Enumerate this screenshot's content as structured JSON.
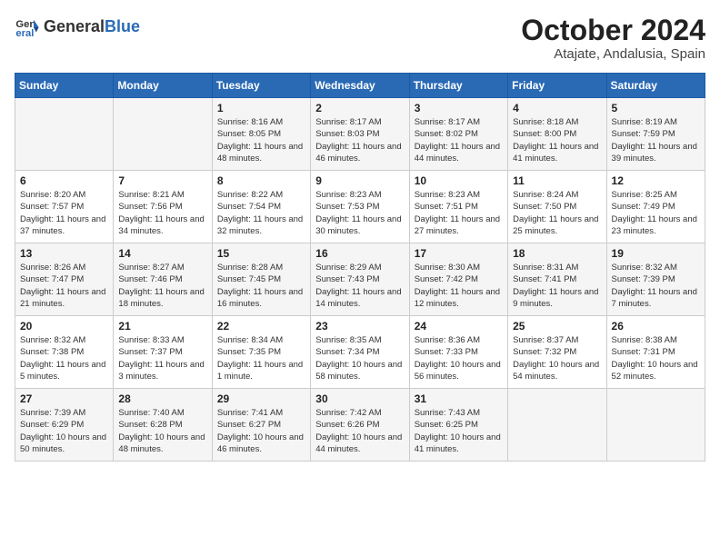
{
  "header": {
    "logo_general": "General",
    "logo_blue": "Blue",
    "month_title": "October 2024",
    "location": "Atajate, Andalusia, Spain"
  },
  "calendar": {
    "days_of_week": [
      "Sunday",
      "Monday",
      "Tuesday",
      "Wednesday",
      "Thursday",
      "Friday",
      "Saturday"
    ],
    "weeks": [
      [
        {
          "day": "",
          "info": ""
        },
        {
          "day": "",
          "info": ""
        },
        {
          "day": "1",
          "info": "Sunrise: 8:16 AM\nSunset: 8:05 PM\nDaylight: 11 hours and 48 minutes."
        },
        {
          "day": "2",
          "info": "Sunrise: 8:17 AM\nSunset: 8:03 PM\nDaylight: 11 hours and 46 minutes."
        },
        {
          "day": "3",
          "info": "Sunrise: 8:17 AM\nSunset: 8:02 PM\nDaylight: 11 hours and 44 minutes."
        },
        {
          "day": "4",
          "info": "Sunrise: 8:18 AM\nSunset: 8:00 PM\nDaylight: 11 hours and 41 minutes."
        },
        {
          "day": "5",
          "info": "Sunrise: 8:19 AM\nSunset: 7:59 PM\nDaylight: 11 hours and 39 minutes."
        }
      ],
      [
        {
          "day": "6",
          "info": "Sunrise: 8:20 AM\nSunset: 7:57 PM\nDaylight: 11 hours and 37 minutes."
        },
        {
          "day": "7",
          "info": "Sunrise: 8:21 AM\nSunset: 7:56 PM\nDaylight: 11 hours and 34 minutes."
        },
        {
          "day": "8",
          "info": "Sunrise: 8:22 AM\nSunset: 7:54 PM\nDaylight: 11 hours and 32 minutes."
        },
        {
          "day": "9",
          "info": "Sunrise: 8:23 AM\nSunset: 7:53 PM\nDaylight: 11 hours and 30 minutes."
        },
        {
          "day": "10",
          "info": "Sunrise: 8:23 AM\nSunset: 7:51 PM\nDaylight: 11 hours and 27 minutes."
        },
        {
          "day": "11",
          "info": "Sunrise: 8:24 AM\nSunset: 7:50 PM\nDaylight: 11 hours and 25 minutes."
        },
        {
          "day": "12",
          "info": "Sunrise: 8:25 AM\nSunset: 7:49 PM\nDaylight: 11 hours and 23 minutes."
        }
      ],
      [
        {
          "day": "13",
          "info": "Sunrise: 8:26 AM\nSunset: 7:47 PM\nDaylight: 11 hours and 21 minutes."
        },
        {
          "day": "14",
          "info": "Sunrise: 8:27 AM\nSunset: 7:46 PM\nDaylight: 11 hours and 18 minutes."
        },
        {
          "day": "15",
          "info": "Sunrise: 8:28 AM\nSunset: 7:45 PM\nDaylight: 11 hours and 16 minutes."
        },
        {
          "day": "16",
          "info": "Sunrise: 8:29 AM\nSunset: 7:43 PM\nDaylight: 11 hours and 14 minutes."
        },
        {
          "day": "17",
          "info": "Sunrise: 8:30 AM\nSunset: 7:42 PM\nDaylight: 11 hours and 12 minutes."
        },
        {
          "day": "18",
          "info": "Sunrise: 8:31 AM\nSunset: 7:41 PM\nDaylight: 11 hours and 9 minutes."
        },
        {
          "day": "19",
          "info": "Sunrise: 8:32 AM\nSunset: 7:39 PM\nDaylight: 11 hours and 7 minutes."
        }
      ],
      [
        {
          "day": "20",
          "info": "Sunrise: 8:32 AM\nSunset: 7:38 PM\nDaylight: 11 hours and 5 minutes."
        },
        {
          "day": "21",
          "info": "Sunrise: 8:33 AM\nSunset: 7:37 PM\nDaylight: 11 hours and 3 minutes."
        },
        {
          "day": "22",
          "info": "Sunrise: 8:34 AM\nSunset: 7:35 PM\nDaylight: 11 hours and 1 minute."
        },
        {
          "day": "23",
          "info": "Sunrise: 8:35 AM\nSunset: 7:34 PM\nDaylight: 10 hours and 58 minutes."
        },
        {
          "day": "24",
          "info": "Sunrise: 8:36 AM\nSunset: 7:33 PM\nDaylight: 10 hours and 56 minutes."
        },
        {
          "day": "25",
          "info": "Sunrise: 8:37 AM\nSunset: 7:32 PM\nDaylight: 10 hours and 54 minutes."
        },
        {
          "day": "26",
          "info": "Sunrise: 8:38 AM\nSunset: 7:31 PM\nDaylight: 10 hours and 52 minutes."
        }
      ],
      [
        {
          "day": "27",
          "info": "Sunrise: 7:39 AM\nSunset: 6:29 PM\nDaylight: 10 hours and 50 minutes."
        },
        {
          "day": "28",
          "info": "Sunrise: 7:40 AM\nSunset: 6:28 PM\nDaylight: 10 hours and 48 minutes."
        },
        {
          "day": "29",
          "info": "Sunrise: 7:41 AM\nSunset: 6:27 PM\nDaylight: 10 hours and 46 minutes."
        },
        {
          "day": "30",
          "info": "Sunrise: 7:42 AM\nSunset: 6:26 PM\nDaylight: 10 hours and 44 minutes."
        },
        {
          "day": "31",
          "info": "Sunrise: 7:43 AM\nSunset: 6:25 PM\nDaylight: 10 hours and 41 minutes."
        },
        {
          "day": "",
          "info": ""
        },
        {
          "day": "",
          "info": ""
        }
      ]
    ]
  }
}
